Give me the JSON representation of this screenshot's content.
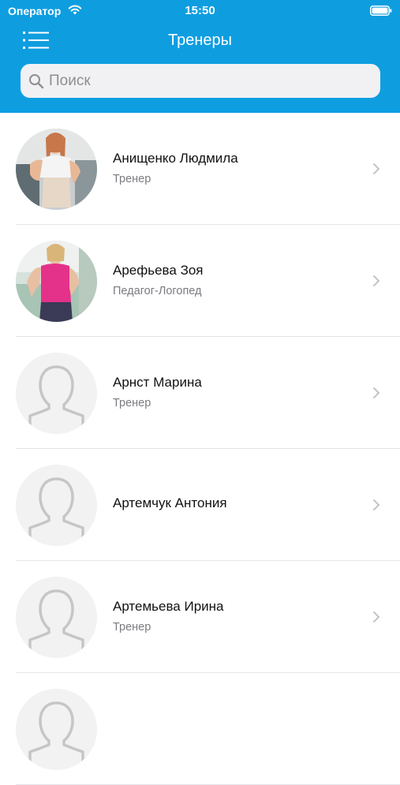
{
  "status_bar": {
    "carrier": "Оператор",
    "time": "15:50"
  },
  "header": {
    "title": "Тренеры"
  },
  "search": {
    "placeholder": "Поиск"
  },
  "colors": {
    "header_bg": "#0e9ee0"
  },
  "trainers": [
    {
      "name": "Анищенко Людмила",
      "role": "Тренер",
      "avatar": "photo-woman-white-top"
    },
    {
      "name": "Арефьева Зоя",
      "role": "Педагог-Логопед",
      "avatar": "photo-woman-pink-top"
    },
    {
      "name": "Арнст Марина",
      "role": "Тренер",
      "avatar": "placeholder-person-icon"
    },
    {
      "name": "Артемчук Антония",
      "role": "",
      "avatar": "placeholder-person-icon"
    },
    {
      "name": "Артемьева Ирина",
      "role": "Тренер",
      "avatar": "placeholder-person-icon"
    },
    {
      "name": "",
      "role": "",
      "avatar": "placeholder-person-icon"
    }
  ]
}
